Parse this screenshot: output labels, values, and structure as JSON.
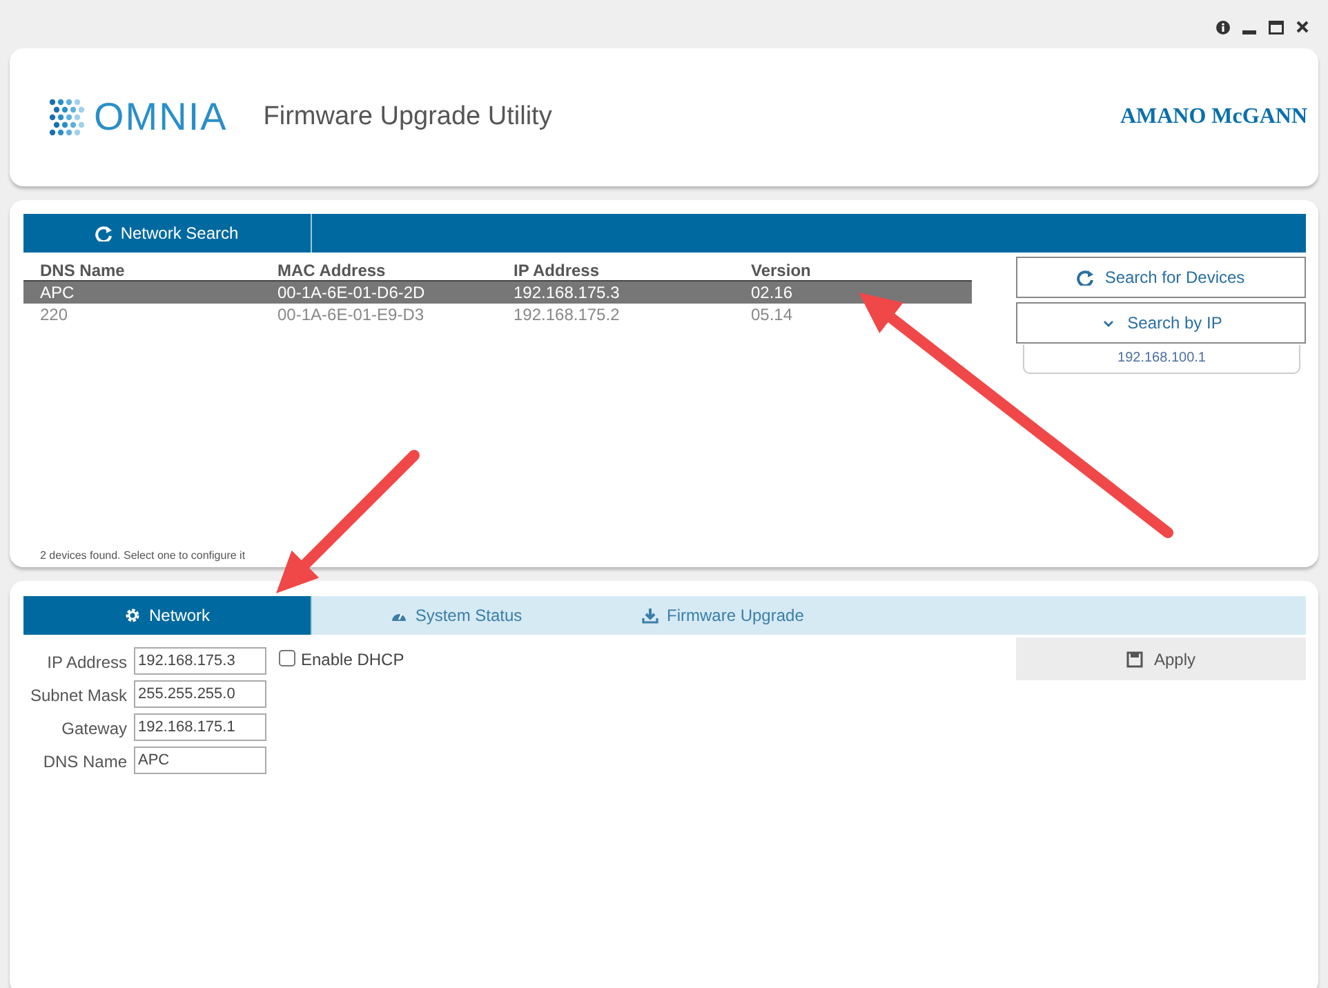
{
  "header": {
    "logo": "OMNIA",
    "title": "Firmware Upgrade Utility",
    "brand": "AMANO McGANN"
  },
  "search_panel": {
    "tabs": [
      {
        "label": "Network Search",
        "selected": true
      }
    ],
    "table": {
      "columns": [
        "DNS Name",
        "MAC Address",
        "IP Address",
        "Version"
      ],
      "rows": [
        {
          "cells": [
            "APC",
            "00-1A-6E-01-D6-2D",
            "192.168.175.3",
            "02.16"
          ],
          "selected": true
        },
        {
          "cells": [
            "220",
            "00-1A-6E-01-E9-D3",
            "192.168.175.2",
            "05.14"
          ],
          "selected": false
        }
      ]
    },
    "buttons": [
      {
        "label": "Search for Devices"
      },
      {
        "label": "Search by IP"
      }
    ],
    "ip_field": {
      "value": "192.168.100.1"
    },
    "status": "2 devices found. Select one to configure it"
  },
  "config_panel": {
    "tabs": [
      {
        "label": "Network",
        "selected": true
      },
      {
        "label": "System Status",
        "selected": false
      },
      {
        "label": "Firmware Upgrade",
        "selected": false
      }
    ],
    "fields": [
      {
        "label": "IP Address",
        "value": "192.168.175.3"
      },
      {
        "label": "Subnet Mask",
        "value": "255.255.255.0"
      },
      {
        "label": "Gateway",
        "value": "192.168.175.1"
      },
      {
        "label": "DNS Name",
        "value": "APC"
      }
    ],
    "dhcp": {
      "label": "Enable DHCP",
      "checked": false
    },
    "apply_button": {
      "label": "Apply"
    }
  }
}
